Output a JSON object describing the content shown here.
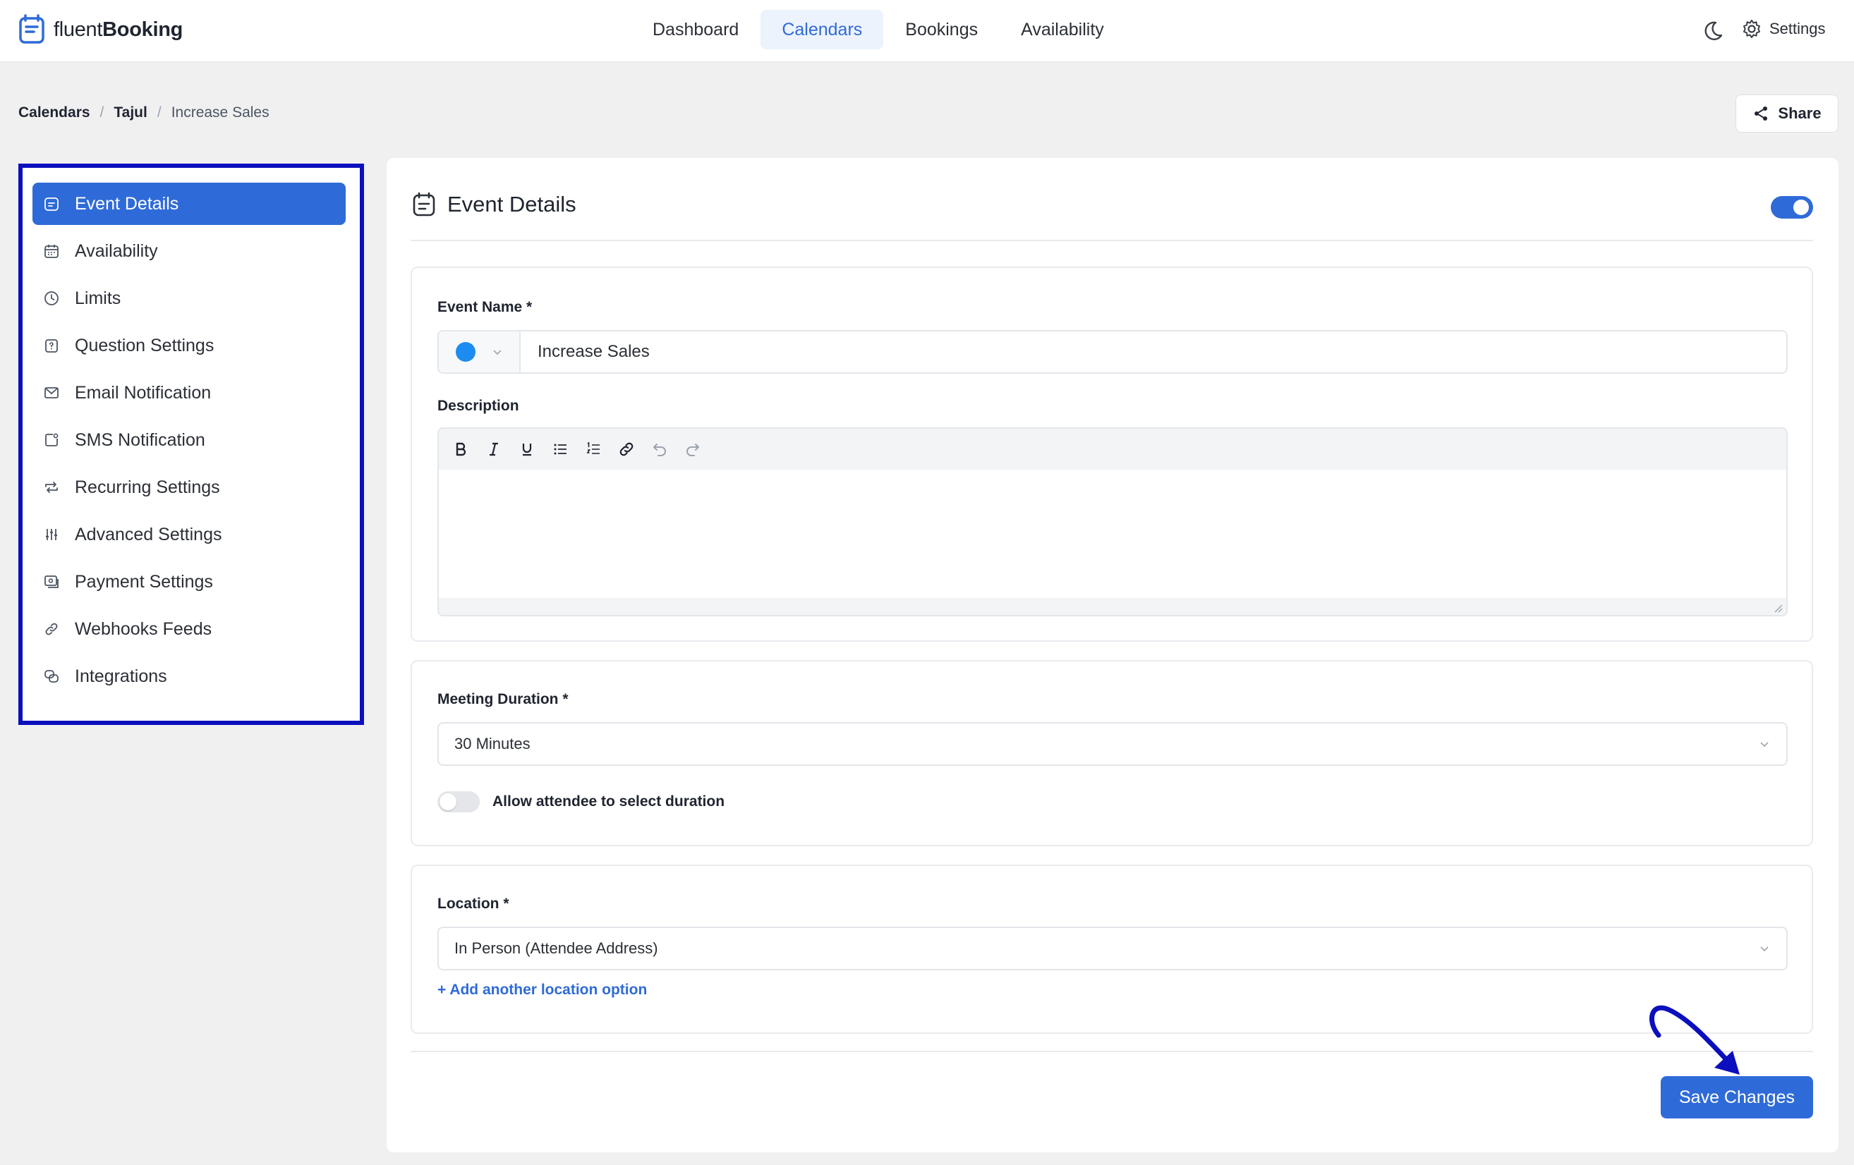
{
  "app": {
    "logo_text_light": "fluent",
    "logo_text_bold": "Booking",
    "logo_icon": "fluentbooking-logo-icon"
  },
  "nav": {
    "items": [
      {
        "label": "Dashboard",
        "active": false
      },
      {
        "label": "Calendars",
        "active": true
      },
      {
        "label": "Bookings",
        "active": false
      },
      {
        "label": "Availability",
        "active": false
      }
    ],
    "dark_mode_icon": "moon-icon",
    "settings_icon": "gear-icon",
    "settings_label": "Settings"
  },
  "breadcrumb": {
    "items": [
      "Calendars",
      "Tajul",
      "Increase Sales"
    ],
    "separator": "/"
  },
  "share": {
    "label": "Share",
    "icon": "share-icon"
  },
  "sidebar": {
    "items": [
      {
        "label": "Event Details",
        "icon": "event-details-icon",
        "active": true
      },
      {
        "label": "Availability",
        "icon": "calendar-icon",
        "active": false
      },
      {
        "label": "Limits",
        "icon": "clock-icon",
        "active": false
      },
      {
        "label": "Question Settings",
        "icon": "question-icon",
        "active": false
      },
      {
        "label": "Email Notification",
        "icon": "mail-icon",
        "active": false
      },
      {
        "label": "SMS Notification",
        "icon": "sms-icon",
        "active": false
      },
      {
        "label": "Recurring Settings",
        "icon": "repeat-icon",
        "active": false
      },
      {
        "label": "Advanced Settings",
        "icon": "sliders-icon",
        "active": false
      },
      {
        "label": "Payment Settings",
        "icon": "payment-icon",
        "active": false
      },
      {
        "label": "Webhooks Feeds",
        "icon": "link-icon",
        "active": false
      },
      {
        "label": "Integrations",
        "icon": "integrations-icon",
        "active": false
      }
    ]
  },
  "main": {
    "title": "Event Details",
    "enabled": true,
    "event_name": {
      "label": "Event Name *",
      "value": "Increase Sales",
      "color": "#1c8cf0"
    },
    "description": {
      "label": "Description",
      "toolbar": [
        "bold-icon",
        "italic-icon",
        "underline-icon",
        "bullet-list-icon",
        "numbered-list-icon",
        "link-icon",
        "undo-icon",
        "redo-icon"
      ],
      "value": ""
    },
    "duration": {
      "label": "Meeting Duration *",
      "value": "30 Minutes",
      "allow_select_label": "Allow attendee to select duration",
      "allow_select": false
    },
    "location": {
      "label": "Location *",
      "value": "In Person (Attendee Address)",
      "add_label": "+ Add another location option"
    },
    "save_label": "Save Changes"
  },
  "colors": {
    "primary": "#2f6bd8",
    "highlight_border": "#0b0fbd"
  }
}
